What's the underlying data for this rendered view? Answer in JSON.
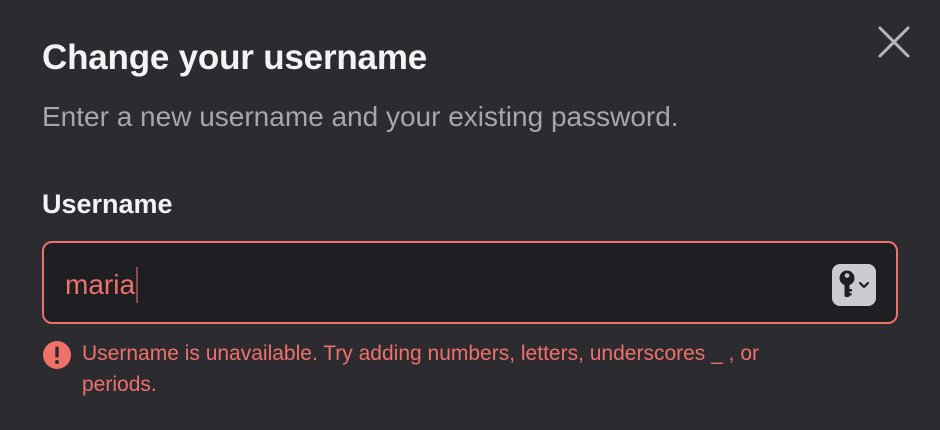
{
  "dialog": {
    "title": "Change your username",
    "subtitle": "Enter a new username and your existing password.",
    "close_icon": "close-icon"
  },
  "username_field": {
    "label": "Username",
    "value": "maria",
    "state": "error",
    "autofill_icon": "key-icon"
  },
  "error": {
    "icon": "exclamation-circle-icon",
    "message": "Username is unavailable. Try adding numbers, letters, underscores _ , or periods."
  },
  "colors": {
    "background": "#2b2b30",
    "input_background": "#1e1f22",
    "title": "#f2f3f5",
    "subtitle": "#a5a7ad",
    "error": "#f0706a",
    "autofill_button": "#cbcbcf"
  }
}
